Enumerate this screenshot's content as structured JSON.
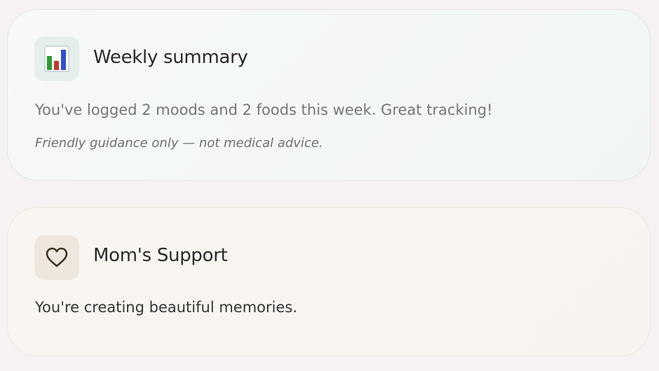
{
  "weekly_card": {
    "title": "Weekly summary",
    "icon": "bar-chart-icon",
    "message": "You've logged 2 moods and 2 foods this week. Great tracking!",
    "note": "Friendly guidance only — not medical advice."
  },
  "support_card": {
    "title": "Mom's Support",
    "icon": "heart-icon",
    "message": "You're creating beautiful memories."
  },
  "colors": {
    "chart_green": "#2e9b2e",
    "chart_red": "#c0392b",
    "chart_blue": "#2f4fd1",
    "heart_stroke": "#3d3326"
  }
}
